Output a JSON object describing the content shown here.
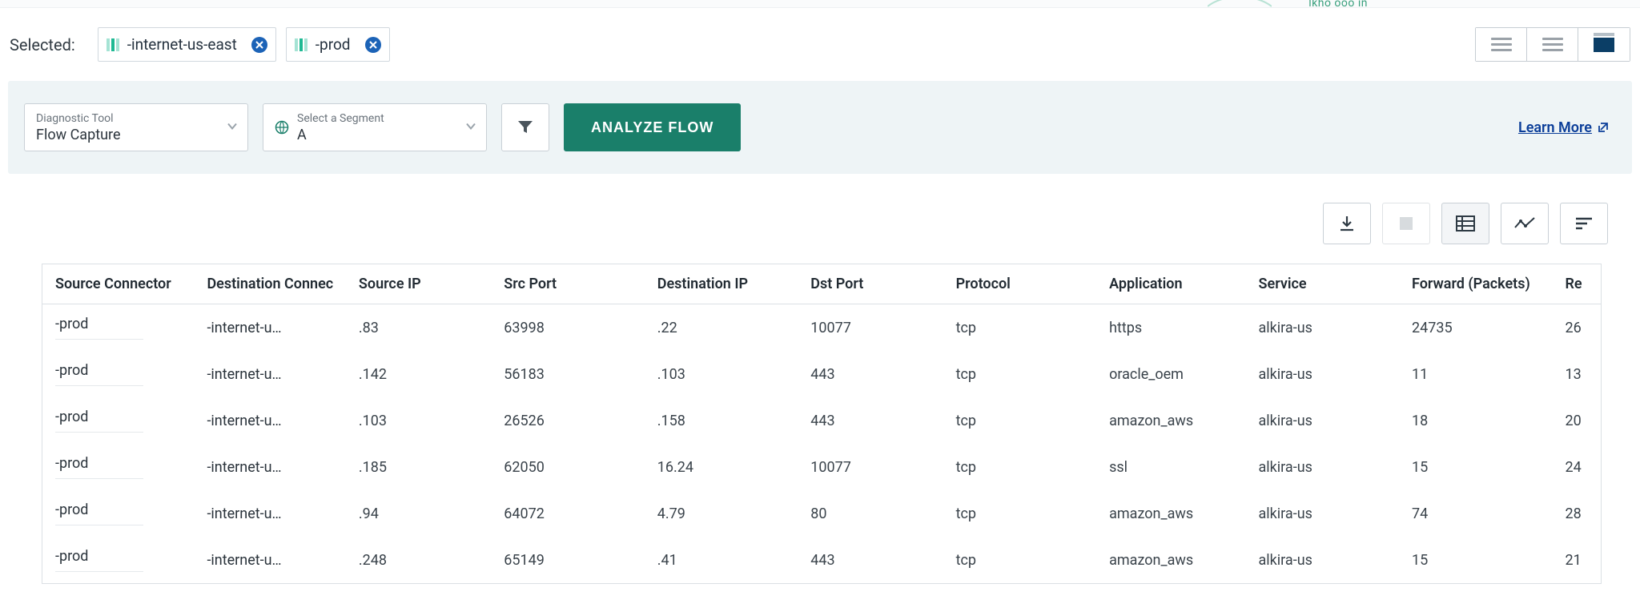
{
  "topHint": "lkho  ooo  in",
  "selected": {
    "label": "Selected:",
    "chips": [
      {
        "text": "-internet-us-east"
      },
      {
        "text": "-prod"
      }
    ]
  },
  "panel": {
    "diagLabel": "Diagnostic Tool",
    "diagValue": "Flow Capture",
    "segLabel": "Select a Segment",
    "segValue": "A",
    "analyze": "ANALYZE FLOW",
    "learnMore": "Learn More"
  },
  "columns": [
    "Source Connector",
    "Destination Connec",
    "Source IP",
    "Src Port",
    "Destination IP",
    "Dst Port",
    "Protocol",
    "Application",
    "Service",
    "Forward (Packets)",
    "Re"
  ],
  "rows": [
    {
      "src": "-prod",
      "dst": "-internet-u…",
      "sip": ".83",
      "sport": "63998",
      "dip": ".22",
      "dport": "10077",
      "proto": "tcp",
      "app": "https",
      "svc": "alkira-us",
      "fwd": "24735",
      "re": "26"
    },
    {
      "src": "-prod",
      "dst": "-internet-u…",
      "sip": ".142",
      "sport": "56183",
      "dip": ".103",
      "dport": "443",
      "proto": "tcp",
      "app": "oracle_oem",
      "svc": "alkira-us",
      "fwd": "11",
      "re": "13"
    },
    {
      "src": "-prod",
      "dst": "-internet-u…",
      "sip": ".103",
      "sport": "26526",
      "dip": ".158",
      "dport": "443",
      "proto": "tcp",
      "app": "amazon_aws",
      "svc": "alkira-us",
      "fwd": "18",
      "re": "20"
    },
    {
      "src": "-prod",
      "dst": "-internet-u…",
      "sip": ".185",
      "sport": "62050",
      "dip": "16.24",
      "dport": "10077",
      "proto": "tcp",
      "app": "ssl",
      "svc": "alkira-us",
      "fwd": "15",
      "re": "24"
    },
    {
      "src": "-prod",
      "dst": "-internet-u…",
      "sip": ".94",
      "sport": "64072",
      "dip": "4.79",
      "dport": "80",
      "proto": "tcp",
      "app": "amazon_aws",
      "svc": "alkira-us",
      "fwd": "74",
      "re": "28"
    },
    {
      "src": "-prod",
      "dst": "-internet-u…",
      "sip": ".248",
      "sport": "65149",
      "dip": ".41",
      "dport": "443",
      "proto": "tcp",
      "app": "amazon_aws",
      "svc": "alkira-us",
      "fwd": "15",
      "re": "21"
    }
  ]
}
